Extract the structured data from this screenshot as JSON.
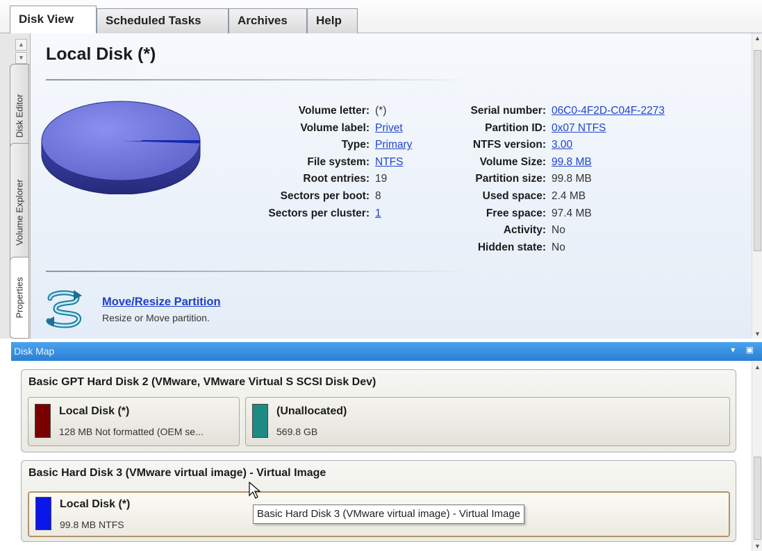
{
  "tabs": [
    {
      "label": "Disk View",
      "active": true
    },
    {
      "label": "Scheduled Tasks",
      "active": false
    },
    {
      "label": "Archives",
      "active": false
    },
    {
      "label": "Help",
      "active": false
    }
  ],
  "side_tabs": [
    {
      "label": "Disk Editor",
      "active": false
    },
    {
      "label": "Volume Explorer",
      "active": false
    },
    {
      "label": "Properties",
      "active": true
    }
  ],
  "volume": {
    "title": "Local Disk (*)",
    "pie_color": "#6a70d6",
    "left_props": [
      {
        "label": "Volume letter:",
        "value": "(*)",
        "link": false
      },
      {
        "label": "Volume label:",
        "value": "Privet",
        "link": true
      },
      {
        "label": "Type:",
        "value": "Primary",
        "link": true
      },
      {
        "label": "File system:",
        "value": "NTFS",
        "link": true
      },
      {
        "label": "Root entries:",
        "value": "19",
        "link": false
      },
      {
        "label": "Sectors per boot:",
        "value": "8",
        "link": false
      },
      {
        "label": "Sectors per cluster:",
        "value": "1",
        "link": true
      }
    ],
    "right_props": [
      {
        "label": "Serial number:",
        "value": "06C0-4F2D-C04F-2273",
        "link": true
      },
      {
        "label": "Partition ID:",
        "value": "0x07 NTFS",
        "link": true
      },
      {
        "label": "NTFS version:",
        "value": "3.00",
        "link": true
      },
      {
        "label": "Volume Size:",
        "value": "99.8 MB",
        "link": true
      },
      {
        "label": "Partition size:",
        "value": "99.8 MB",
        "link": false
      },
      {
        "label": "Used space:",
        "value": "2.4 MB",
        "link": false
      },
      {
        "label": "Free space:",
        "value": "97.4 MB",
        "link": false
      },
      {
        "label": "Activity:",
        "value": "No",
        "link": false
      },
      {
        "label": "Hidden state:",
        "value": "No",
        "link": false
      }
    ]
  },
  "action": {
    "title": "Move/Resize Partition",
    "description": "Resize or Move partition.",
    "icon": "move-resize-icon"
  },
  "disk_map": {
    "title": "Disk Map",
    "disks": [
      {
        "title": "Basic GPT Hard Disk 2 (VMware, VMware Virtual S SCSI Disk Dev)",
        "partitions": [
          {
            "name": "Local Disk (*)",
            "info": "128 MB Not formatted (OEM se...",
            "color": "#7a0000",
            "selected": false
          },
          {
            "name": "(Unallocated)",
            "info": "569.8 GB",
            "color": "#1e8a84",
            "selected": false
          }
        ]
      },
      {
        "title": "Basic Hard Disk 3 (VMware virtual image) - Virtual Image",
        "partitions": [
          {
            "name": "Local Disk (*)",
            "info": "99.8 MB NTFS",
            "color": "#0b16e8",
            "selected": true
          }
        ]
      }
    ]
  },
  "tooltip": "Basic Hard Disk 3 (VMware virtual image) - Virtual Image"
}
